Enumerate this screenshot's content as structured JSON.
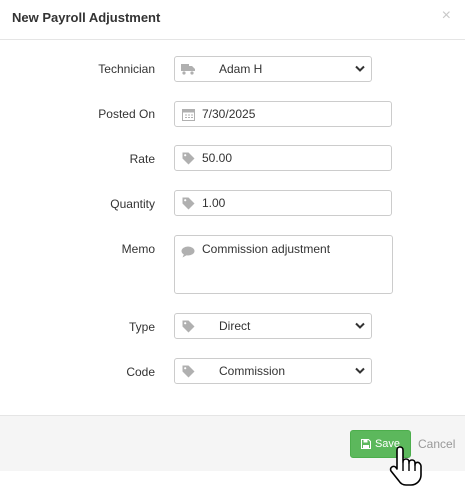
{
  "dialog": {
    "title": "New Payroll Adjustment",
    "close_icon": "×"
  },
  "form": {
    "technician": {
      "label": "Technician",
      "value": "Adam H",
      "icon": "truck-icon"
    },
    "posted_on": {
      "label": "Posted On",
      "value": "7/30/2025",
      "icon": "calendar-icon"
    },
    "rate": {
      "label": "Rate",
      "value": "50.00",
      "icon": "tag-icon"
    },
    "quantity": {
      "label": "Quantity",
      "value": "1.00",
      "icon": "tag-icon"
    },
    "memo": {
      "label": "Memo",
      "value": "Commission adjustment",
      "icon": "comment-icon"
    },
    "type": {
      "label": "Type",
      "value": "Direct",
      "icon": "tag-icon"
    },
    "code": {
      "label": "Code",
      "value": "Commission",
      "icon": "tag-icon"
    }
  },
  "footer": {
    "save_label": "Save",
    "cancel_label": "Cancel"
  },
  "colors": {
    "save_button": "#5cb85c",
    "icon_gray": "#b0b0b0"
  }
}
